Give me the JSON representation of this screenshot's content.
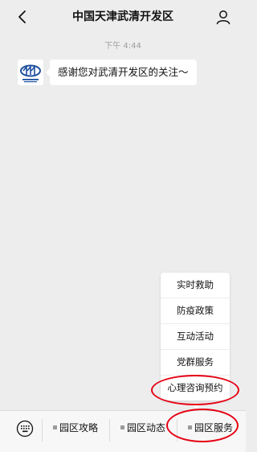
{
  "header": {
    "title": "中国天津武清开发区",
    "back_icon": "chevron-left-icon",
    "profile_icon": "person-icon"
  },
  "chat": {
    "timestamp": "下午 4:44",
    "messages": [
      {
        "sender": "official-account",
        "text": "感谢您对武清开发区的关注～"
      }
    ]
  },
  "submenu": {
    "items": [
      "实时救助",
      "防疫政策",
      "互动活动",
      "党群服务",
      "心理咨询预约"
    ],
    "highlighted": "心理咨询预约"
  },
  "bottom_menu": {
    "keyboard_icon": "keyboard-icon",
    "tabs": [
      "园区攻略",
      "园区动态",
      "园区服务"
    ],
    "highlighted": "园区服务"
  },
  "colors": {
    "background": "#ededed",
    "bubble": "#ffffff",
    "annotation": "#e60012",
    "logo": "#1f4fa0"
  }
}
